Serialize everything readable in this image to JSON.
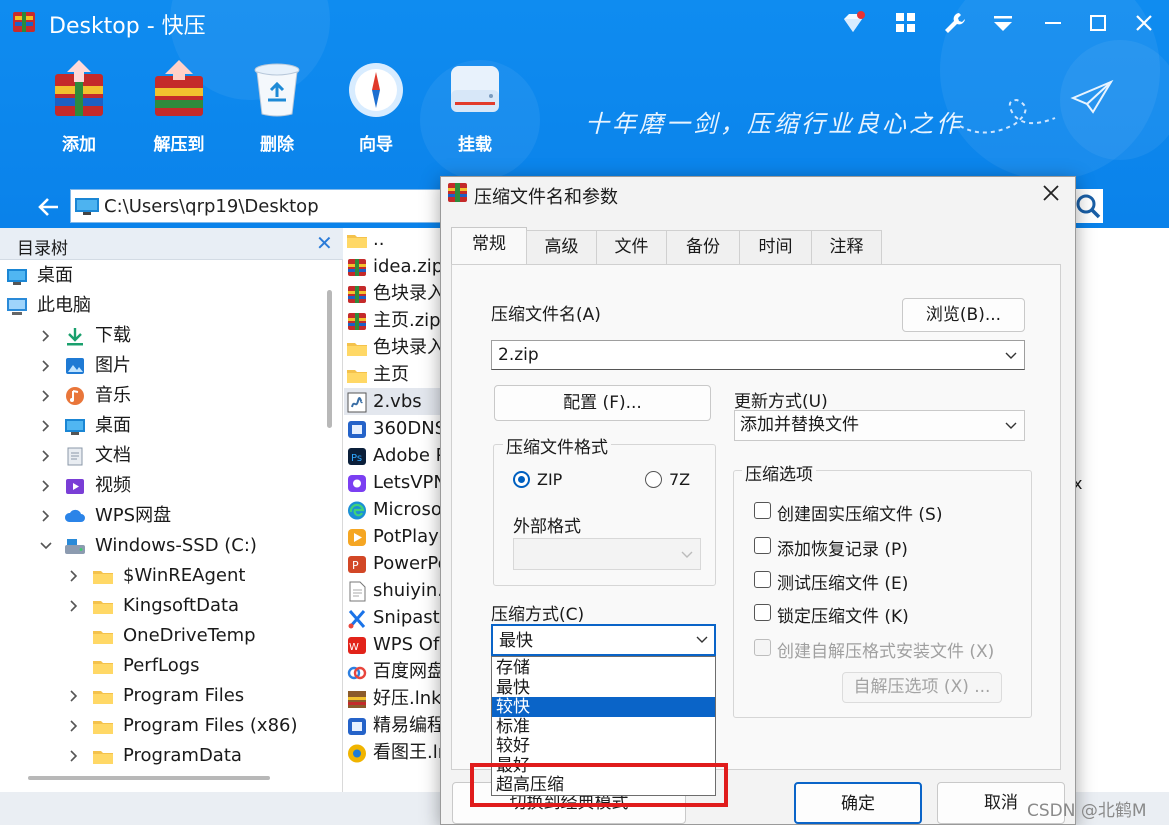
{
  "window": {
    "title": "Desktop - 快压",
    "controls": [
      "diamond-icon",
      "grid-icon",
      "wrench-icon",
      "menu-icon",
      "minimize-icon",
      "maximize-icon",
      "close-icon"
    ]
  },
  "toolbar": {
    "items": [
      {
        "label": "添加",
        "icon": "add-archive-icon"
      },
      {
        "label": "解压到",
        "icon": "extract-icon"
      },
      {
        "label": "删除",
        "icon": "recycle-bin-icon"
      },
      {
        "label": "向导",
        "icon": "compass-icon"
      },
      {
        "label": "挂载",
        "icon": "drive-icon"
      }
    ],
    "slogan": "十年磨一剑，压缩行业良心之作"
  },
  "address": {
    "path": "C:\\Users\\qrp19\\Desktop"
  },
  "tree": {
    "header": "目录树",
    "items": [
      {
        "label": "桌面",
        "icon": "desktop-icon"
      },
      {
        "label": "此电脑",
        "icon": "computer-icon"
      },
      {
        "label": "下载",
        "icon": "download-icon"
      },
      {
        "label": "图片",
        "icon": "pictures-icon"
      },
      {
        "label": "音乐",
        "icon": "music-icon"
      },
      {
        "label": "桌面",
        "icon": "desktop-icon"
      },
      {
        "label": "文档",
        "icon": "documents-icon"
      },
      {
        "label": "视频",
        "icon": "videos-icon"
      },
      {
        "label": "WPS网盘",
        "icon": "cloud-icon"
      },
      {
        "label": "Windows-SSD (C:)",
        "icon": "drive-c-icon"
      },
      {
        "label": "$WinREAgent",
        "icon": "folder-icon"
      },
      {
        "label": "KingsoftData",
        "icon": "folder-icon"
      },
      {
        "label": "OneDriveTemp",
        "icon": "folder-icon"
      },
      {
        "label": "PerfLogs",
        "icon": "folder-icon"
      },
      {
        "label": "Program Files",
        "icon": "folder-icon"
      },
      {
        "label": "Program Files (x86)",
        "icon": "folder-icon"
      },
      {
        "label": "ProgramData",
        "icon": "folder-icon"
      }
    ]
  },
  "files": {
    "items": [
      {
        "label": "..",
        "icon": "folder-icon"
      },
      {
        "label": "idea.zip",
        "icon": "archive-icon"
      },
      {
        "label": "色块录入",
        "icon": "archive-icon"
      },
      {
        "label": "主页.zip",
        "icon": "archive-icon"
      },
      {
        "label": "色块录入",
        "icon": "folder-icon"
      },
      {
        "label": "主页",
        "icon": "folder-icon"
      },
      {
        "label": "2.vbs",
        "icon": "script-icon"
      },
      {
        "label": "360DNS",
        "icon": "app-icon"
      },
      {
        "label": "Adobe P",
        "icon": "photoshop-icon"
      },
      {
        "label": "LetsVPN",
        "icon": "vpn-icon"
      },
      {
        "label": "Microso",
        "icon": "edge-icon"
      },
      {
        "label": "PotPlaye",
        "icon": "potplayer-icon"
      },
      {
        "label": "PowerPo",
        "icon": "powerpoint-icon"
      },
      {
        "label": "shuiyin.",
        "icon": "file-icon"
      },
      {
        "label": "Snipaste",
        "icon": "snipaste-icon"
      },
      {
        "label": "WPS Of",
        "icon": "wps-icon"
      },
      {
        "label": "百度网盘",
        "icon": "baidu-icon"
      },
      {
        "label": "好压.lnk",
        "icon": "haozip-icon"
      },
      {
        "label": "精易编程",
        "icon": "app-icon"
      },
      {
        "label": "看图王.ln",
        "icon": "viewer-icon"
      }
    ]
  },
  "right_fragment": "x",
  "dialog": {
    "title": "压缩文件名和参数",
    "tabs": [
      "常规",
      "高级",
      "文件",
      "备份",
      "时间",
      "注释"
    ],
    "archive_name_label": "压缩文件名(A)",
    "browse_label": "浏览(B)...",
    "archive_name_value": "2.zip",
    "profile_label": "配置 (F)...",
    "update_mode_label": "更新方式(U)",
    "update_mode_value": "添加并替换文件",
    "format_group": "压缩文件格式",
    "format_zip": "ZIP",
    "format_7z": "7Z",
    "external_format_label": "外部格式",
    "options_group": "压缩选项",
    "options": [
      {
        "label": "创建固实压缩文件 (S)",
        "enabled": true
      },
      {
        "label": "添加恢复记录 (P)",
        "enabled": true
      },
      {
        "label": "测试压缩文件 (E)",
        "enabled": true
      },
      {
        "label": "锁定压缩文件 (K)",
        "enabled": true
      },
      {
        "label": "创建自解压格式安装文件 (X)",
        "enabled": false
      }
    ],
    "sfx_options_label": "自解压选项 (X) ...",
    "method_label": "压缩方式(C)",
    "method_value": "最快",
    "method_options": [
      "存储",
      "最快",
      "较快",
      "标准",
      "较好",
      "最好",
      "超高压缩"
    ],
    "method_selected_index": 2,
    "switch_mode_label": "切换到经典模式",
    "ok_label": "确定",
    "cancel_label": "取消"
  },
  "watermark": "CSDN @北鹤M"
}
